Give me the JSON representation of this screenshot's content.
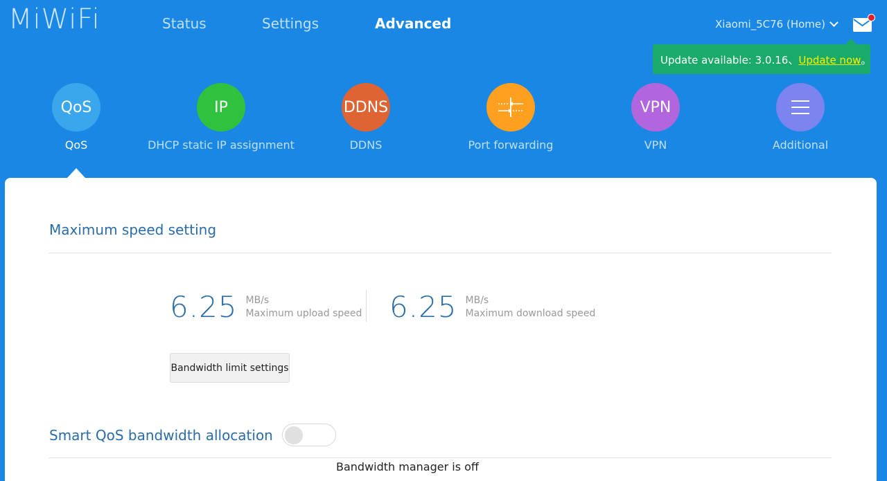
{
  "brand": {
    "logo": "MiWiFi"
  },
  "nav": {
    "tabs": [
      {
        "label": "Status"
      },
      {
        "label": "Settings"
      },
      {
        "label": "Advanced"
      }
    ]
  },
  "router": {
    "name": "Xiaomi_5C76 (Home)"
  },
  "notification": {
    "text": "Update available: 3.0.16、",
    "link": "Update now",
    "suffix": "。"
  },
  "tools": [
    {
      "icon_text": "QoS",
      "label": "QoS",
      "color": "#3aa6ec"
    },
    {
      "icon_text": "IP",
      "label": "DHCP static IP assignment",
      "color": "#30c13f"
    },
    {
      "icon_text": "DDNS",
      "label": "DDNS",
      "color": "#de6434"
    },
    {
      "icon": "port-forwarding-icon",
      "label": "Port forwarding",
      "color": "#ffa020"
    },
    {
      "icon_text": "VPN",
      "label": "VPN",
      "color": "#b266dd"
    },
    {
      "icon": "menu-icon",
      "label": "Additional",
      "color": "#7b84ef"
    }
  ],
  "max_speed": {
    "title": "Maximum speed setting",
    "upload": {
      "value": "6.25",
      "unit": "MB/s",
      "label": "Maximum upload speed"
    },
    "download": {
      "value": "6.25",
      "unit": "MB/s",
      "label": "Maximum download speed"
    },
    "button": "Bandwidth limit settings"
  },
  "smart_qos": {
    "title": "Smart QoS bandwidth allocation",
    "enabled": false,
    "status": "Bandwidth manager is off"
  }
}
